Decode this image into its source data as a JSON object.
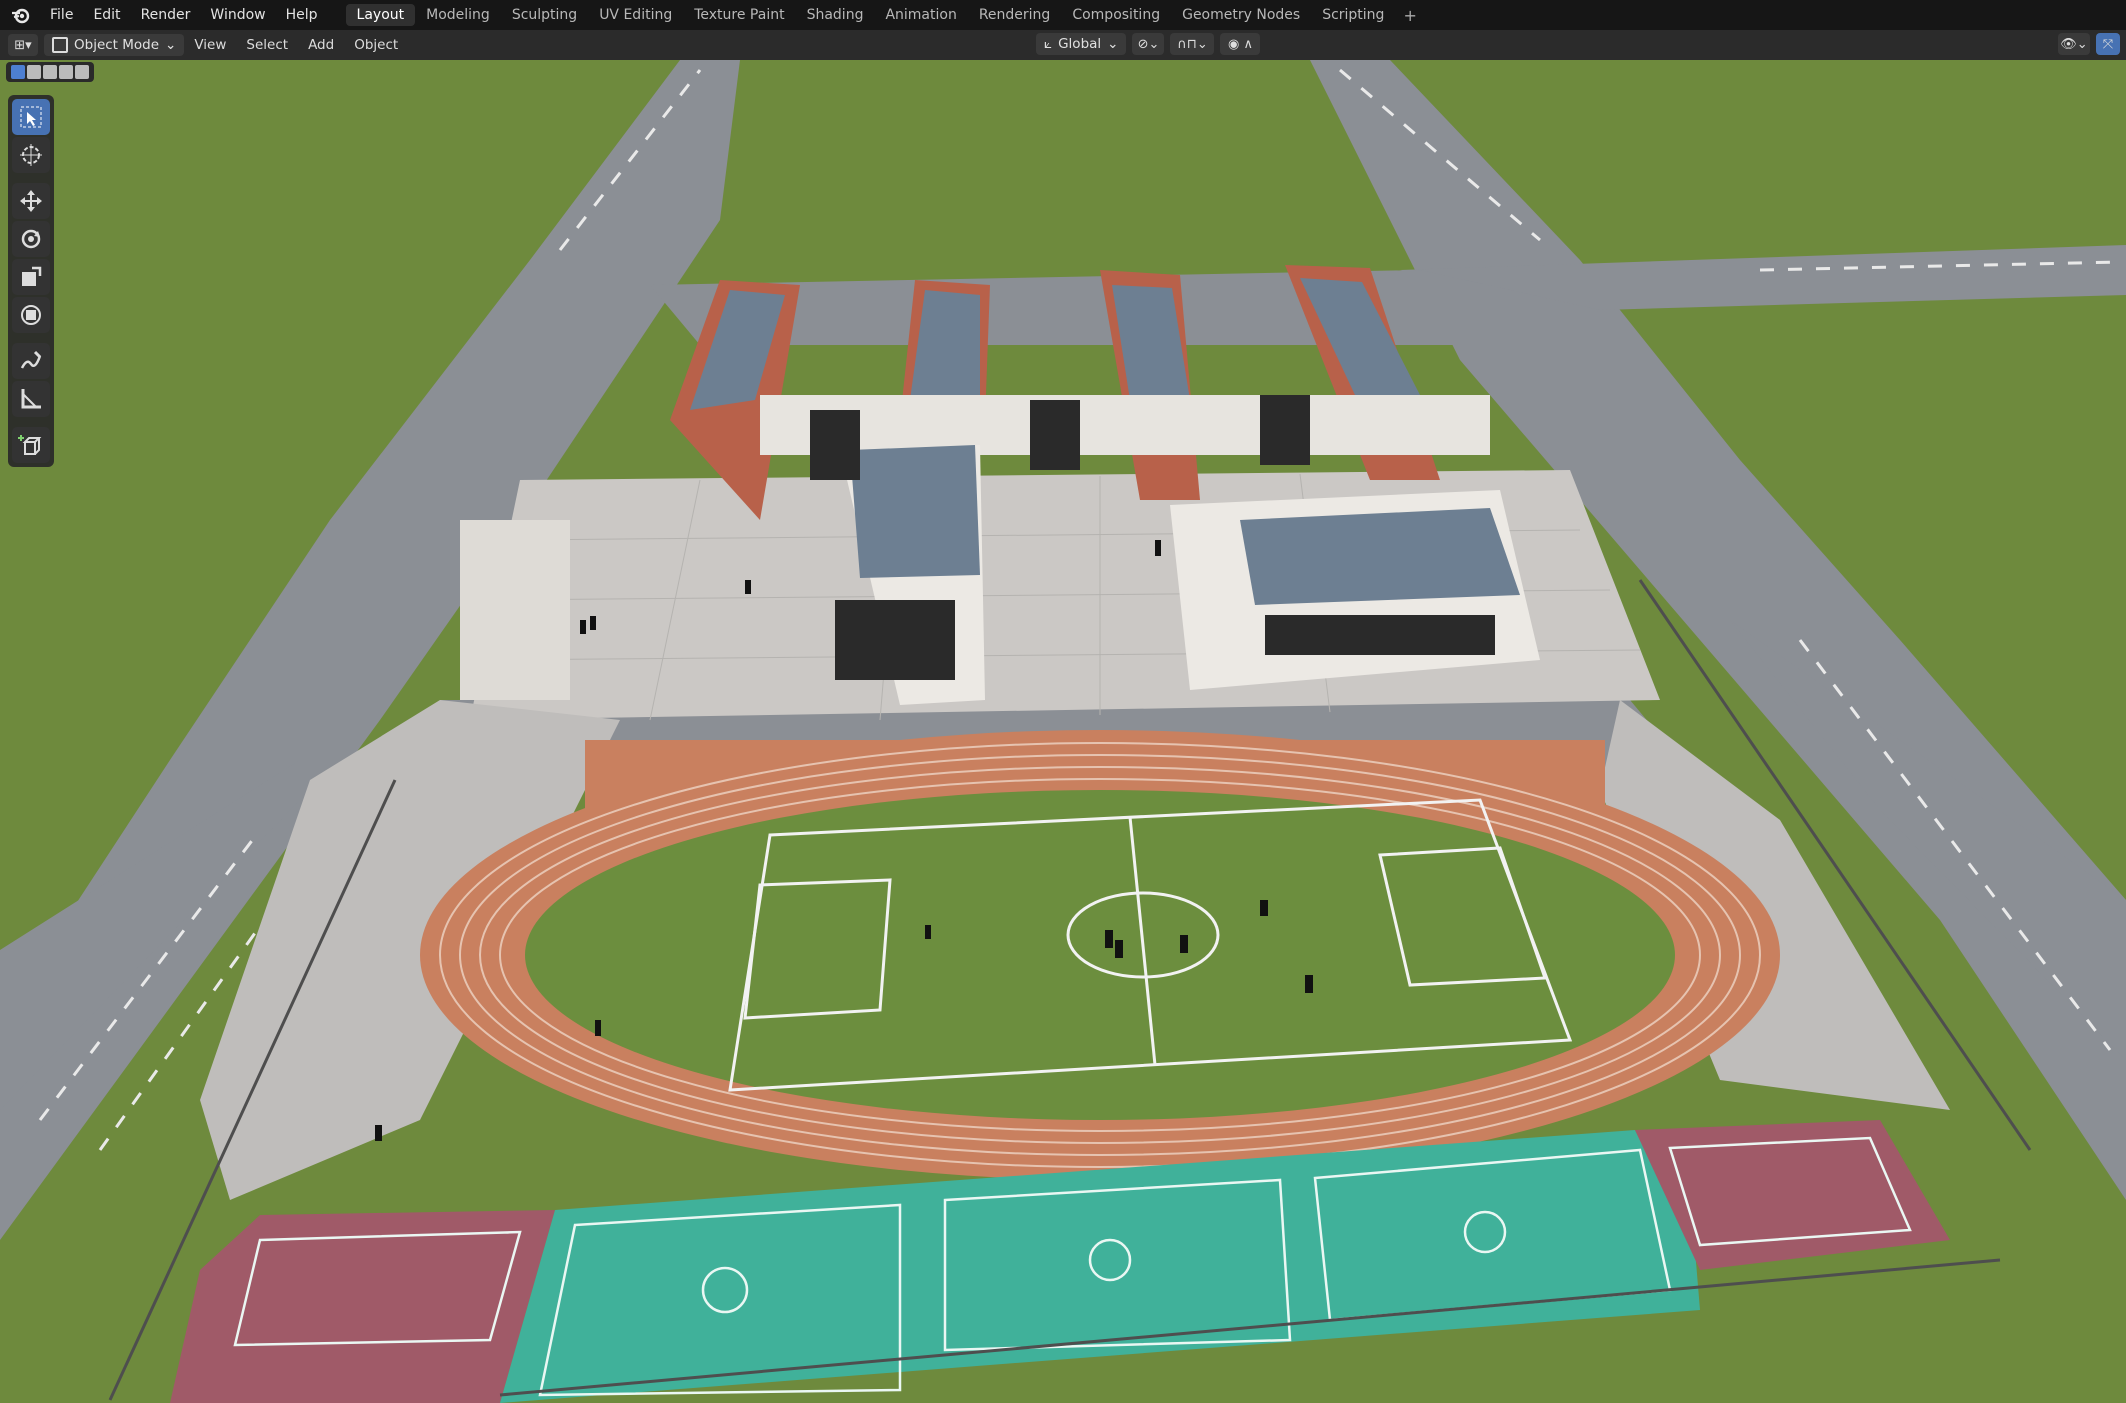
{
  "menu": [
    "File",
    "Edit",
    "Render",
    "Window",
    "Help"
  ],
  "workspaces": [
    "Layout",
    "Modeling",
    "Sculpting",
    "UV Editing",
    "Texture Paint",
    "Shading",
    "Animation",
    "Rendering",
    "Compositing",
    "Geometry Nodes",
    "Scripting"
  ],
  "active_workspace": "Layout",
  "add_workspace": "+",
  "header": {
    "mode": "Object Mode",
    "menus": [
      "View",
      "Select",
      "Add",
      "Object"
    ],
    "orientation": "Global"
  },
  "toolbar": [
    "select-box",
    "cursor",
    "move",
    "rotate",
    "scale",
    "transform",
    "annotate",
    "measure",
    "add-cube"
  ],
  "colors": {
    "grass": "#6f8a3c",
    "road": "#8d9096",
    "track": "#c77f5f",
    "court": "#3fb39c",
    "courtRed": "#a25a68",
    "brick": "#b8614a",
    "roof": "#6d7f92"
  }
}
